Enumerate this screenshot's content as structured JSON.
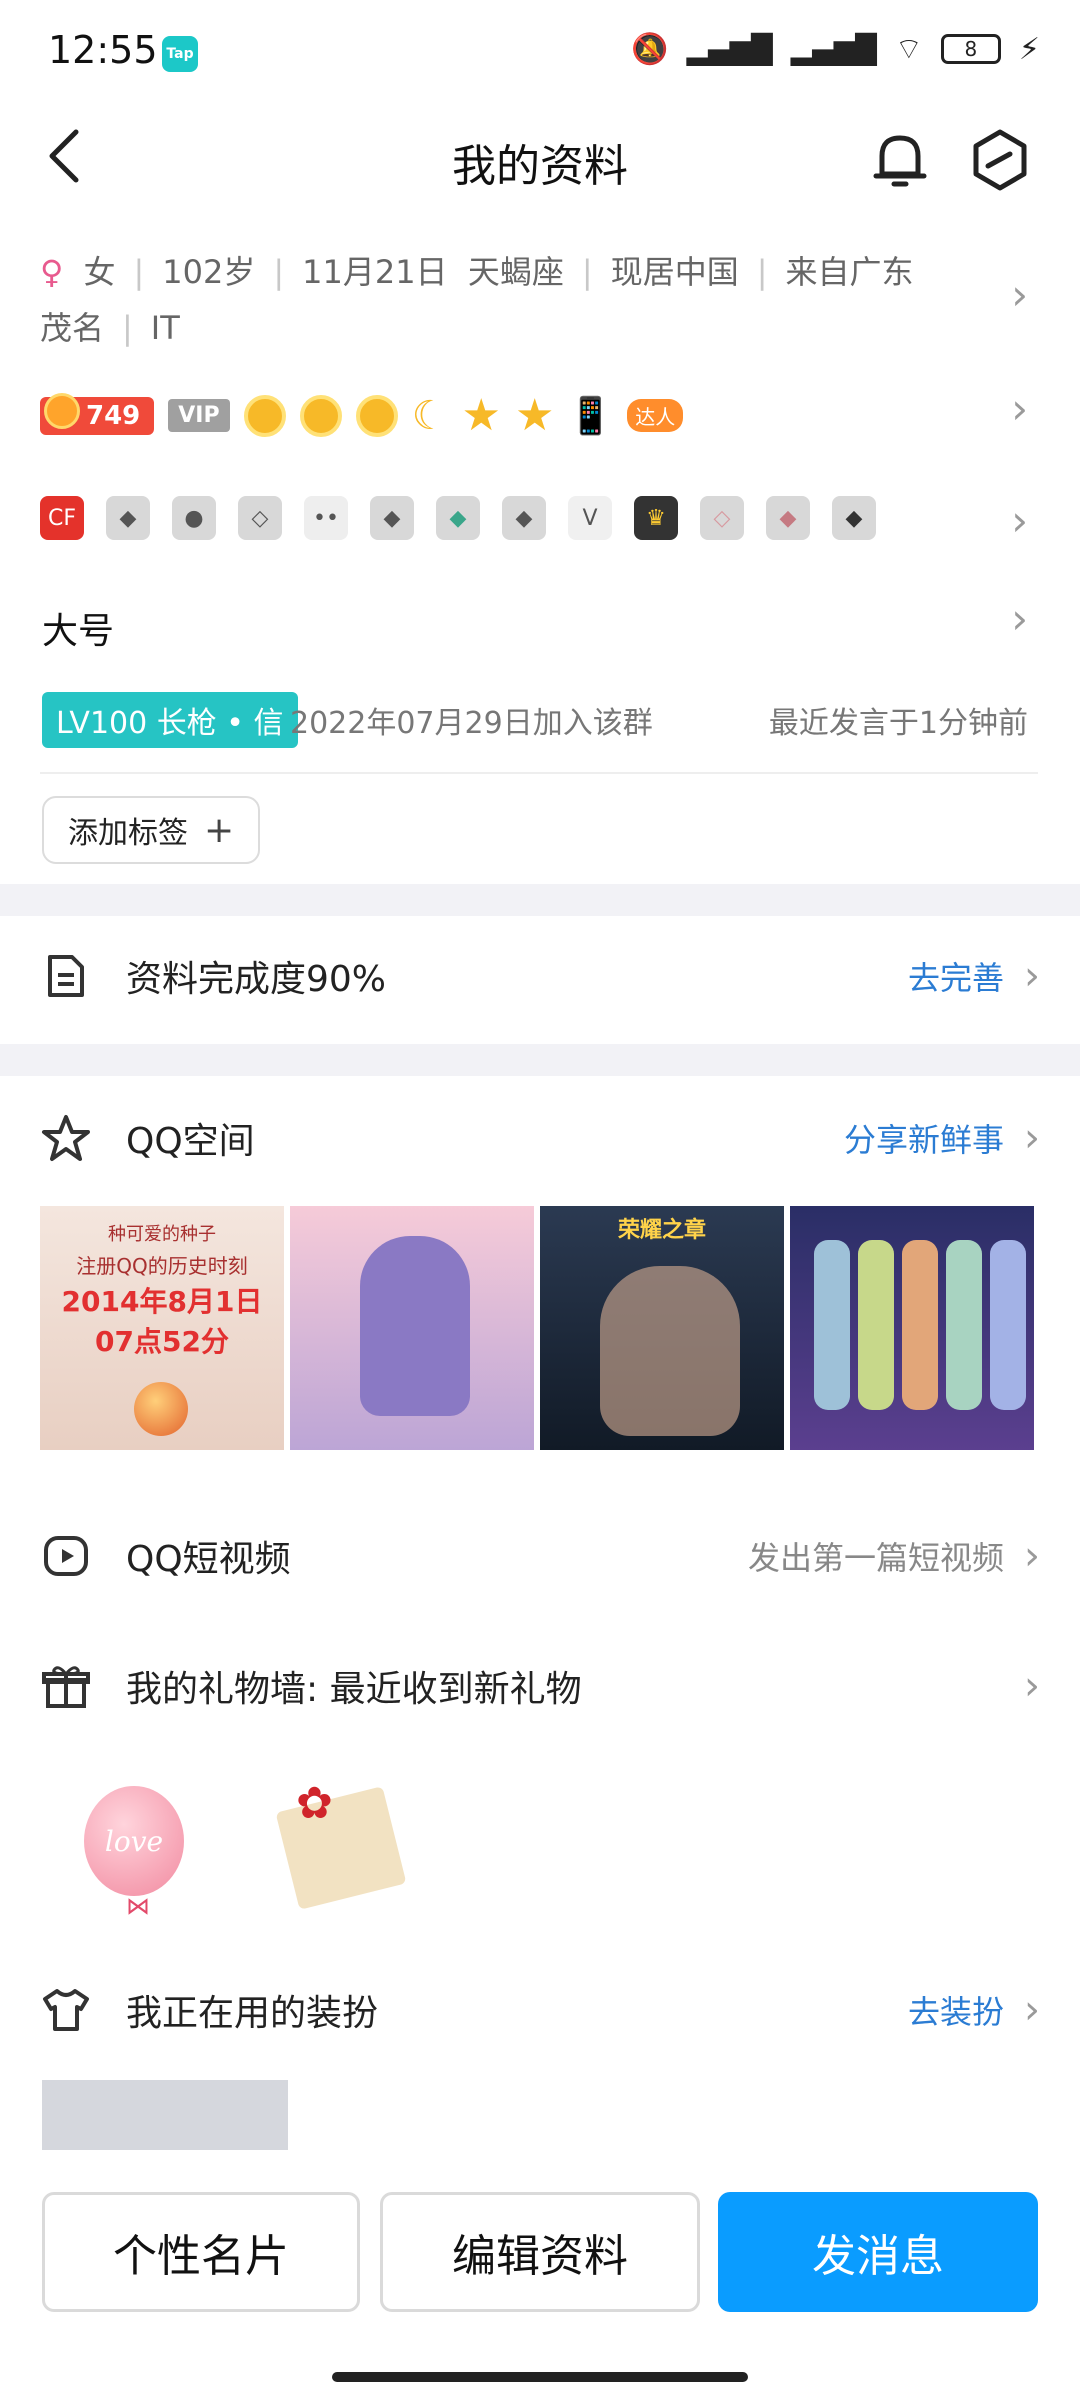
{
  "status_bar": {
    "time": "12:55",
    "app_badge": "Tap",
    "battery": "8"
  },
  "header": {
    "title": "我的资料"
  },
  "profile_info": {
    "gender_symbol": "♀",
    "gender": "女",
    "age": "102岁",
    "birthday": "11月21日",
    "zodiac": "天蝎座",
    "residence": "现居中国",
    "hometown": "来自广东",
    "city": "茂名",
    "industry": "IT"
  },
  "grade": {
    "coin_value": "749",
    "vip_label": "VIP",
    "daren_label": "达人"
  },
  "group_card": {
    "name": "大号",
    "level_tag": "LV100 长枪 • 信",
    "join_text": "2022年07月29日加入该群",
    "last_speak": "最近发言于1分钟前",
    "add_tag_label": "添加标签",
    "add_tag_plus": "+"
  },
  "completeness": {
    "label": "资料完成度90%",
    "action": "去完善"
  },
  "qzone": {
    "label": "QQ空间",
    "action": "分享新鲜事",
    "photo1_small": "种可爱的种子",
    "photo1_title": "注册QQ的历史时刻",
    "photo1_date": "2014年8月1日",
    "photo1_time": "07点52分",
    "photo3_title": "荣耀之章"
  },
  "short_video": {
    "label": "QQ短视频",
    "action": "发出第一篇短视频"
  },
  "gift_wall": {
    "label": "我的礼物墙: 最近收到新礼物",
    "balloon_text": "love"
  },
  "outfit": {
    "label": "我正在用的装扮",
    "action": "去装扮"
  },
  "bottom_bar": {
    "card_label": "个性名片",
    "edit_label": "编辑资料",
    "message_label": "发消息"
  },
  "colors": {
    "primary_blue": "#0a9cff",
    "link_blue": "#2b7cd3",
    "teal": "#26c4c4"
  }
}
